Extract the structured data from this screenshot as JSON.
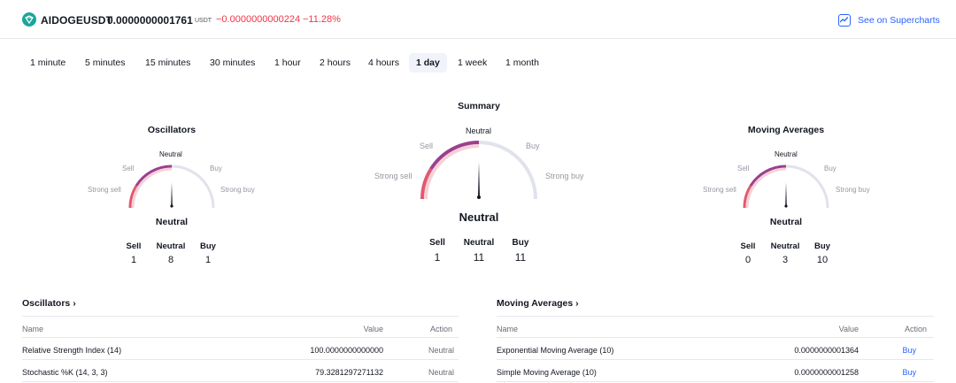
{
  "header": {
    "symbol": "AIDOGEUSDT",
    "price": "0.0000000001761",
    "currency": "USDT",
    "change": "−0.0000000000224",
    "change_pct": "−11.28%",
    "supercharts_label": "See on Supercharts"
  },
  "tabs": [
    "1 minute",
    "5 minutes",
    "15 minutes",
    "30 minutes",
    "1 hour",
    "2 hours",
    "4 hours",
    "1 day",
    "1 week",
    "1 month"
  ],
  "active_tab": "1 day",
  "gauge_labels": {
    "strong_sell": "Strong sell",
    "sell": "Sell",
    "neutral": "Neutral",
    "buy": "Buy",
    "strong_buy": "Strong buy"
  },
  "gauges": {
    "oscillators": {
      "title": "Oscillators",
      "verdict": "Neutral",
      "counts": {
        "sell": "1",
        "neutral": "8",
        "buy": "1"
      },
      "needle_level": 0.5
    },
    "summary": {
      "title": "Summary",
      "verdict": "Neutral",
      "counts": {
        "sell": "1",
        "neutral": "11",
        "buy": "11"
      },
      "needle_level": 0.5
    },
    "moving_averages": {
      "title": "Moving Averages",
      "verdict": "Neutral",
      "counts": {
        "sell": "0",
        "neutral": "3",
        "buy": "10"
      },
      "needle_level": 0.5
    }
  },
  "count_headers": {
    "sell": "Sell",
    "neutral": "Neutral",
    "buy": "Buy"
  },
  "oscillators_table": {
    "title": "Oscillators ›",
    "columns": {
      "name": "Name",
      "value": "Value",
      "action": "Action"
    },
    "rows": [
      {
        "name": "Relative Strength Index (14)",
        "value": "100.0000000000000",
        "action": "Neutral"
      },
      {
        "name": "Stochastic %K (14, 3, 3)",
        "value": "79.3281297271132",
        "action": "Neutral"
      }
    ]
  },
  "moving_averages_table": {
    "title": "Moving Averages ›",
    "columns": {
      "name": "Name",
      "value": "Value",
      "action": "Action"
    },
    "rows": [
      {
        "name": "Exponential Moving Average (10)",
        "value": "0.0000000001364",
        "action": "Buy"
      },
      {
        "name": "Simple Moving Average (10)",
        "value": "0.0000000001258",
        "action": "Buy"
      }
    ]
  },
  "colors": {
    "accent": "#2962ff",
    "negative": "#f23645",
    "sell_arc": "#e05a70",
    "neutral_arc": "#9c3f8e",
    "track": "#e0e3eb"
  }
}
